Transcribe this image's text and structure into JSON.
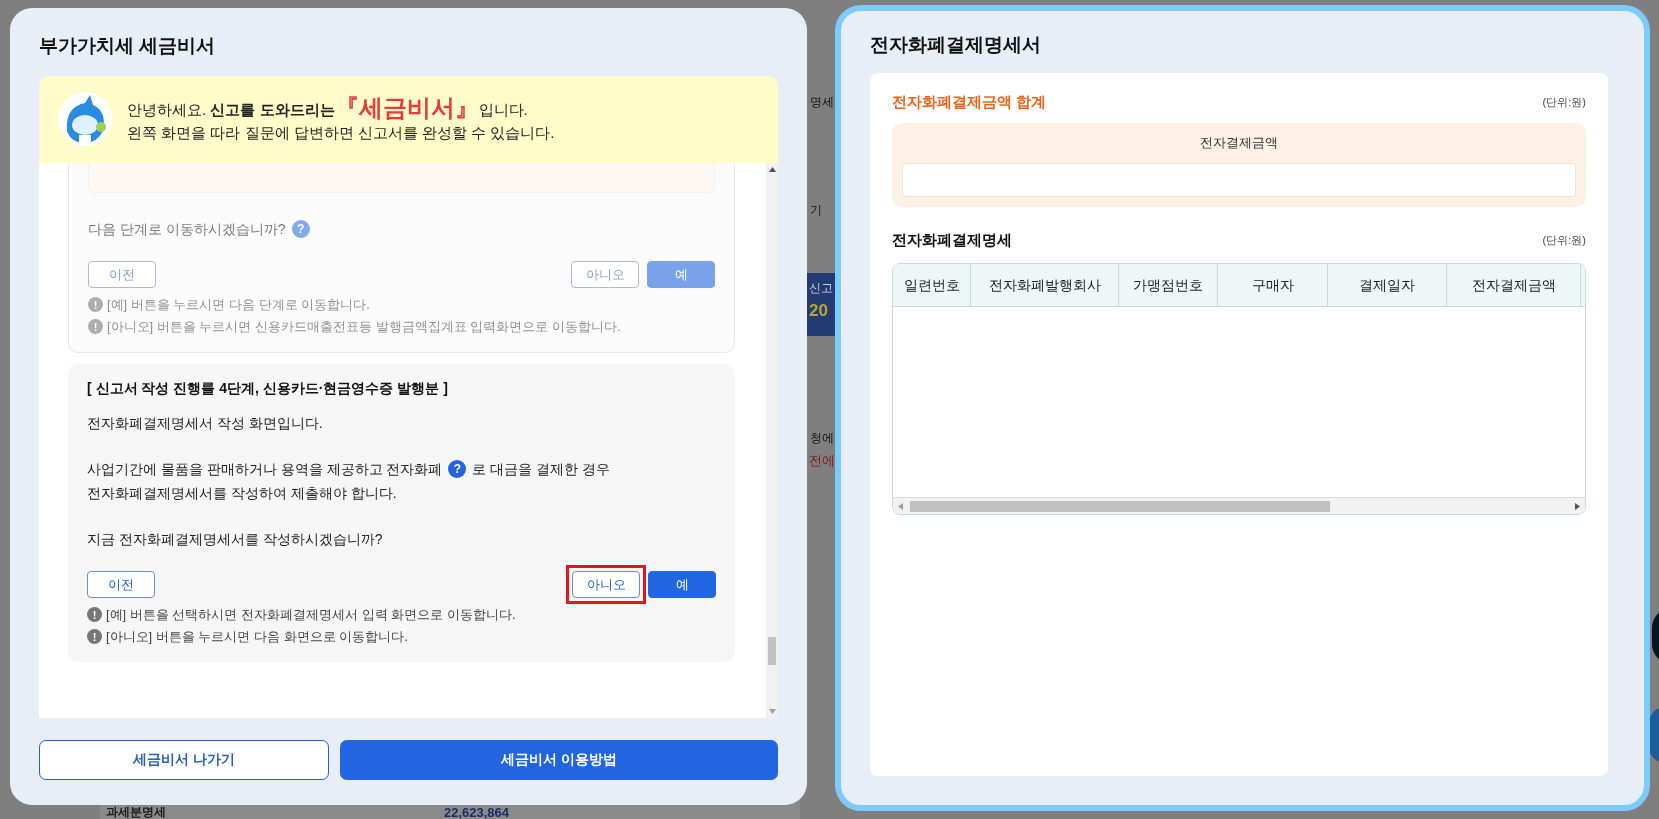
{
  "background_fragments": [
    {
      "kind": "text",
      "text": "명세"
    },
    {
      "kind": "text",
      "text": "기"
    },
    {
      "kind": "banner",
      "text": "신고"
    },
    {
      "kind": "banner_number",
      "text": "20"
    },
    {
      "kind": "text",
      "text": "청에"
    },
    {
      "kind": "alert",
      "text": "전에"
    },
    {
      "kind": "bottom_label",
      "text": "과세분명세"
    },
    {
      "kind": "bottom_number",
      "text": "22,623,864"
    }
  ],
  "left_panel": {
    "title": "부가가치세 세금비서",
    "banner": {
      "line1_before": "안녕하세요. **신고를 도와드리는** ",
      "highlight": "『세금비서』",
      "line1_after": "입니다.",
      "line2": "왼쪽 화면을 따라 질문에 답변하면 신고서를 완성할 수 있습니다."
    },
    "cards": [
      {
        "disabled": true,
        "paragraphs": [
          {
            "text": "다음 단계로 이동하시겠습니까?",
            "help": "?"
          }
        ],
        "buttons": [
          {
            "label": "이전",
            "kind": "back",
            "highlighted": false
          },
          {
            "label": "아니오",
            "kind": "outline",
            "highlighted": false
          },
          {
            "label": "예",
            "kind": "primary",
            "highlighted": false
          }
        ],
        "notes": [
          {
            "mark": "!",
            "text": "[예] 버튼을 누르시면 다음 단계로 이동합니다."
          },
          {
            "mark": "!",
            "text": "[아니오] 버튼을 누르시면 신용카드매출전표등 발행금액집계표 입력화면으로 이동합니다."
          }
        ]
      },
      {
        "disabled": false,
        "heading": "[ 신고서 작성 진행률 4단계, 신용카드·현금영수증 발행분 ]",
        "paragraphs": [
          {
            "text": "전자화폐결제명세서 작성 화면입니다."
          },
          {
            "text": "사업기간에 물품을 판매하거나 용역을 제공하고 전자화폐",
            "help": "?",
            "text_after": "로 대금을 결제한 경우\n전자화폐결제명세서를 작성하여 제출해야 합니다."
          },
          {
            "text": "지금 전자화폐결제명세서를 작성하시겠습니까?"
          }
        ],
        "buttons": [
          {
            "label": "이전",
            "kind": "back",
            "highlighted": false
          },
          {
            "label": "아니오",
            "kind": "outline",
            "highlighted": true
          },
          {
            "label": "예",
            "kind": "primary",
            "highlighted": false
          }
        ],
        "notes": [
          {
            "mark": "!",
            "text": "[예] 버튼을 선택하시면 전자화폐결제명세서 입력 화면으로 이동합니다."
          },
          {
            "mark": "!",
            "text": "[아니오] 버튼을 누르시면 다음 화면으로 이동합니다."
          }
        ]
      }
    ],
    "footer_buttons": [
      {
        "label": "세금비서 나가기",
        "kind": "outline"
      },
      {
        "label": "세금비서 이용방법",
        "kind": "primary"
      }
    ]
  },
  "right_panel": {
    "title": "전자화폐결제명세서",
    "total_section": {
      "title": "전자화폐결제금액 합계",
      "unit": "(단위:원)",
      "field_label": "전자결제금액"
    },
    "detail_section": {
      "title": "전자화폐결제명세",
      "unit": "(단위:원)",
      "table": {
        "columns": [
          "일련번호",
          "전자화폐발행회사",
          "가맹점번호",
          "구매자",
          "결제일자",
          "전자결제금액"
        ]
      }
    }
  }
}
